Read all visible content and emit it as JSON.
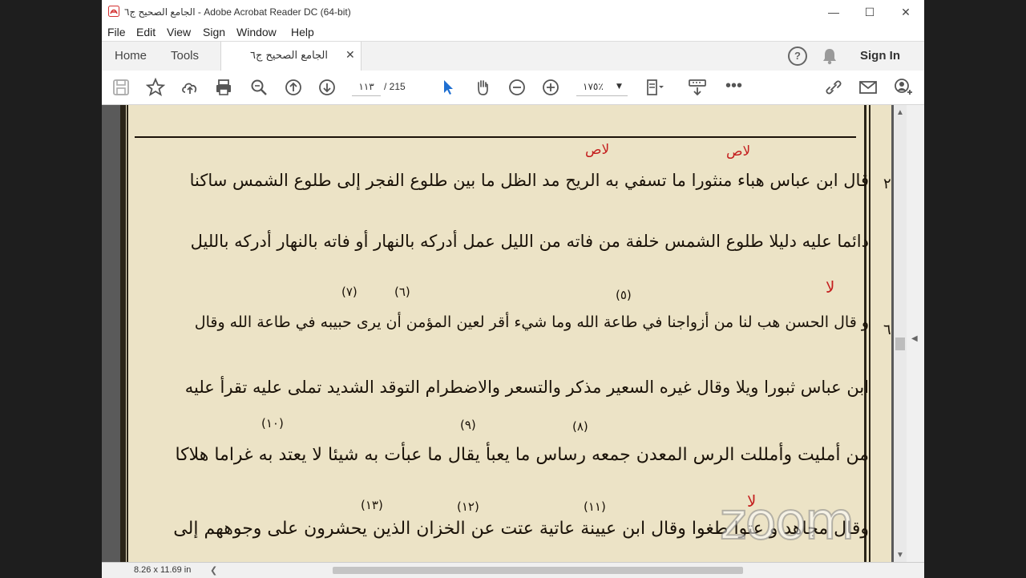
{
  "window": {
    "title": "الجامع الصحيح ج٦ - Adobe Acrobat Reader DC (64-bit)"
  },
  "menu": [
    "File",
    "Edit",
    "View",
    "Sign",
    "Window",
    "Help"
  ],
  "tabs": {
    "home": "Home",
    "tools": "Tools",
    "document": "الجامع الصحيح ج٦",
    "sign_in": "Sign In"
  },
  "toolbar": {
    "page_current": "١١٣",
    "page_total": "/ 215",
    "zoom": "١٧٥٪"
  },
  "status": {
    "page_size": "8.26 x 11.69 in"
  },
  "document_lines": [
    "قال ابن عباس هباء منثورا ما تسفي به الريح مد الظل ما بين طلوع الفجر إلى طلوع الشمس ساكنا",
    "دائما عليه دليلا طلوع الشمس خلفة من فاته من الليل عمل أدركه بالنهار أو فاته بالنهار أدركه بالليل",
    "و قال الحسن هب لنا من أزواجنا في طاعة الله وما شيء أقر لعين المؤمن أن يرى حبيبه في طاعة الله وقال",
    "ابن عباس ثبورا ويلا وقال غيره السعير مذكر والتسعر والاضطرام التوقد الشديد تملى عليه تقرأ عليه",
    "من أمليت وأمللت الرس المعدن جمعه رساس ما يعبأ يقال ما عبأت به شيئا لا يعتد به غراما هلاكا",
    "وقال مجاهد و عتوا طغوا وقال ابن عيينة عاتية عتت عن الخزان الذين يحشرون على وجوههم إلى"
  ],
  "annotations": {
    "la_s_1": "لاص",
    "la_s_2": "لاص",
    "la_1": "لا",
    "la_2": "لا",
    "n5": "(٥)",
    "n6": "(٦)",
    "n7": "(٧)",
    "n8": "(٨)",
    "n9": "(٩)",
    "n10": "(١٠)",
    "n11": "(١١)",
    "n12": "(١٢)",
    "n13": "(١٣)",
    "margin_2": "٢",
    "margin_6": "٦"
  },
  "watermark": "zoom"
}
